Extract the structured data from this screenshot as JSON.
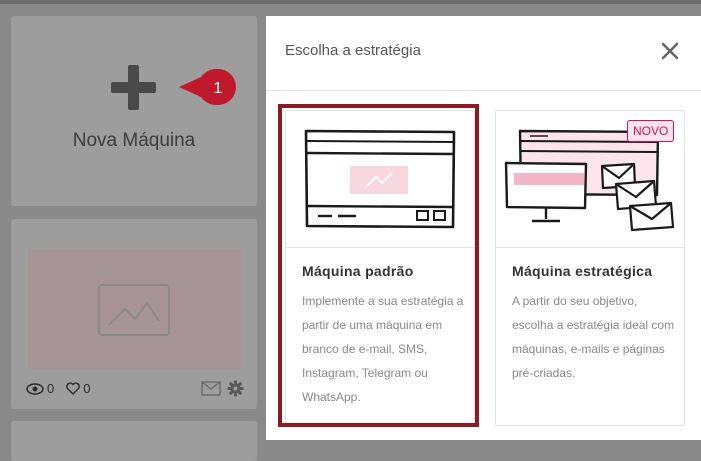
{
  "background": {
    "new_machine_label": "Nova Máquina",
    "step_badge": "1",
    "machine_card": {
      "views": "0",
      "likes": "0"
    }
  },
  "modal": {
    "title": "Escolha a estratégia",
    "options": [
      {
        "title": "Máquina padrão",
        "description": "Implemente a sua estratégia a partir de uma máquina em branco de e-mail, SMS, Instagram, Telegram ou WhatsApp.",
        "selected": true
      },
      {
        "title": "Máquina estratégica",
        "description": "A partir do seu objetivo, escolha a estratégia ideal com máquinas, e-mails e páginas pré-criadas.",
        "tag": "NOVO",
        "selected": false
      }
    ]
  },
  "colors": {
    "selected_border": "#8b1c24",
    "badge_red": "#c0192c",
    "tag_pink": "#c2185b",
    "illustration_pink": "#f8d7de"
  },
  "icons": [
    "plus-icon",
    "close-icon",
    "eye-icon",
    "heart-icon",
    "mail-icon",
    "gear-icon",
    "image-icon"
  ]
}
